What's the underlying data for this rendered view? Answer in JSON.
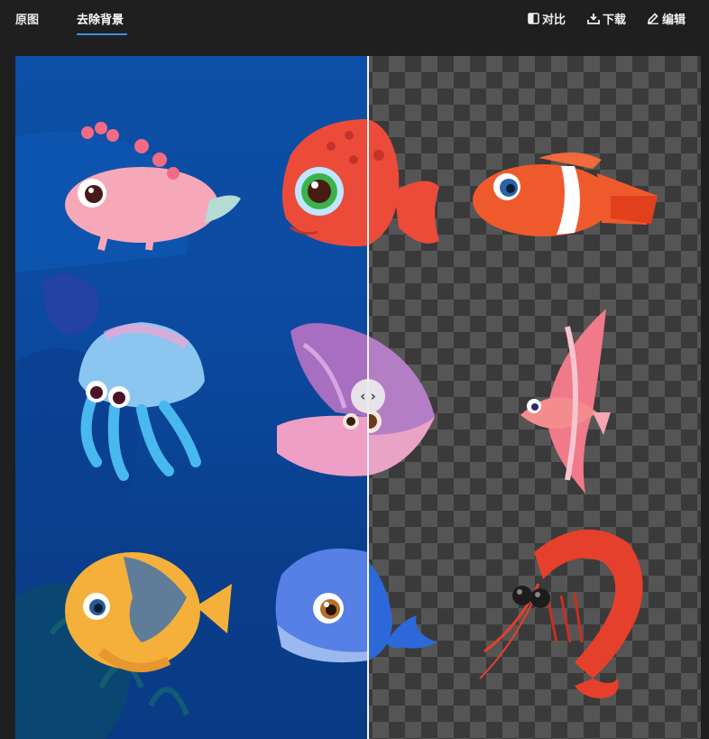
{
  "tabs": {
    "original_label": "原图",
    "remove_bg_label": "去除背景"
  },
  "actions": {
    "compare_label": "对比",
    "download_label": "下载",
    "edit_label": "编辑"
  },
  "compare_handle": {
    "glyph": "‹ ›",
    "split_fraction": 0.51
  },
  "colors": {
    "accent": "#3d8ee9",
    "background": "#1f1f1f",
    "ocean": "#0b4aa0"
  },
  "icons": {
    "compare": "compare-icon",
    "download": "download-icon",
    "edit": "edit-icon"
  }
}
